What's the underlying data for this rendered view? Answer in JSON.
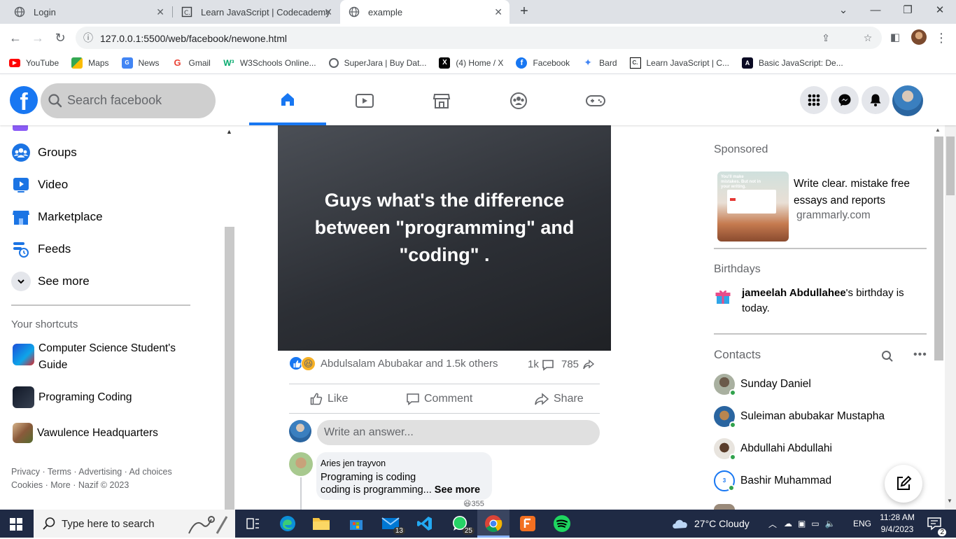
{
  "browser": {
    "tabs": [
      {
        "title": "Login",
        "icon": "globe-icon"
      },
      {
        "title": "Learn JavaScript | Codecademy",
        "icon": "codecademy-icon"
      },
      {
        "title": "example",
        "icon": "globe-icon"
      }
    ],
    "url": "127.0.0.1:5500/web/facebook/newone.html",
    "bookmarks": [
      {
        "label": "YouTube",
        "icon": "youtube-icon",
        "color": "#ff0000"
      },
      {
        "label": "Maps",
        "icon": "maps-icon",
        "color": "#34a853"
      },
      {
        "label": "News",
        "icon": "news-icon",
        "color": "#4285f4"
      },
      {
        "label": "Gmail",
        "icon": "google-icon",
        "color": "#ea4335"
      },
      {
        "label": "W3Schools Online...",
        "icon": "w3schools-icon",
        "color": "#04aa6d"
      },
      {
        "label": "SuperJara | Buy Dat...",
        "icon": "globe-icon",
        "color": "#5f6368"
      },
      {
        "label": "(4) Home / X",
        "icon": "x-icon",
        "color": "#000000"
      },
      {
        "label": "Facebook",
        "icon": "facebook-icon",
        "color": "#1877f2"
      },
      {
        "label": "Bard",
        "icon": "bard-icon",
        "color": "#4285f4"
      },
      {
        "label": "Learn JavaScript | C...",
        "icon": "codecademy-icon",
        "color": "#000000"
      },
      {
        "label": "Basic JavaScript: De...",
        "icon": "freecodecamp-icon",
        "color": "#0a0a23"
      }
    ]
  },
  "facebook": {
    "search_placeholder": "Search facebook",
    "brand_color": "#1877f2",
    "nav": [
      "home-icon",
      "watch-icon",
      "marketplace-icon",
      "groups-icon",
      "gaming-icon"
    ],
    "sidebar": {
      "items": [
        {
          "label": "Groups",
          "icon": "groups-icon"
        },
        {
          "label": "Video",
          "icon": "video-icon"
        },
        {
          "label": "Marketplace",
          "icon": "marketplace-icon"
        },
        {
          "label": "Feeds",
          "icon": "feeds-icon"
        },
        {
          "label": "See more",
          "icon": "chevron-down-icon"
        }
      ],
      "shortcuts_heading": "Your shortcuts",
      "shortcuts": [
        {
          "label": "Computer Science Student's Guide"
        },
        {
          "label": "Programing Coding"
        },
        {
          "label": "Vawulence Headquarters"
        }
      ],
      "footer_line1": "Privacy · Terms · Advertising · Ad choices",
      "footer_line2": "Cookies · More · Nazif © 2023"
    },
    "post": {
      "text": "Guys what's the difference between \"programming\" and \"coding\" .",
      "reactions_text": "Abdulsalam Abubakar and 1.5k others",
      "comments_count": "1k",
      "shares_count": "785",
      "like_label": "Like",
      "comment_label": "Comment",
      "share_label": "Share",
      "answer_placeholder": "Write an answer...",
      "comment": {
        "author": "Aries jen trayvon",
        "line1": "Programing is coding",
        "line2": "coding is programming...",
        "see_more": "See more",
        "reaction_count": "355"
      }
    },
    "right": {
      "sponsored_heading": "Sponsored",
      "ad_text": "Write clear. mistake free essays and reports",
      "ad_domain": "grammarly.com",
      "ad_image_text": "You'll make mistakes. But not in your writing.",
      "birthdays_heading": "Birthdays",
      "birthday_name": "jameelah Abdullahee",
      "birthday_rest": "'s birthday is today.",
      "contacts_heading": "Contacts",
      "contacts": [
        {
          "name": "Sunday Daniel"
        },
        {
          "name": "Suleiman abubakar Mustapha"
        },
        {
          "name": "Abdullahi Abdullahi"
        },
        {
          "name": "Bashir Muhammad"
        }
      ]
    }
  },
  "taskbar": {
    "search_placeholder": "Type here to search",
    "mail_badge": "13",
    "whatsapp_badge": "25",
    "weather": "27°C  Cloudy",
    "lang": "ENG",
    "time": "11:28 AM",
    "date": "9/4/2023",
    "notif_badge": "2"
  }
}
